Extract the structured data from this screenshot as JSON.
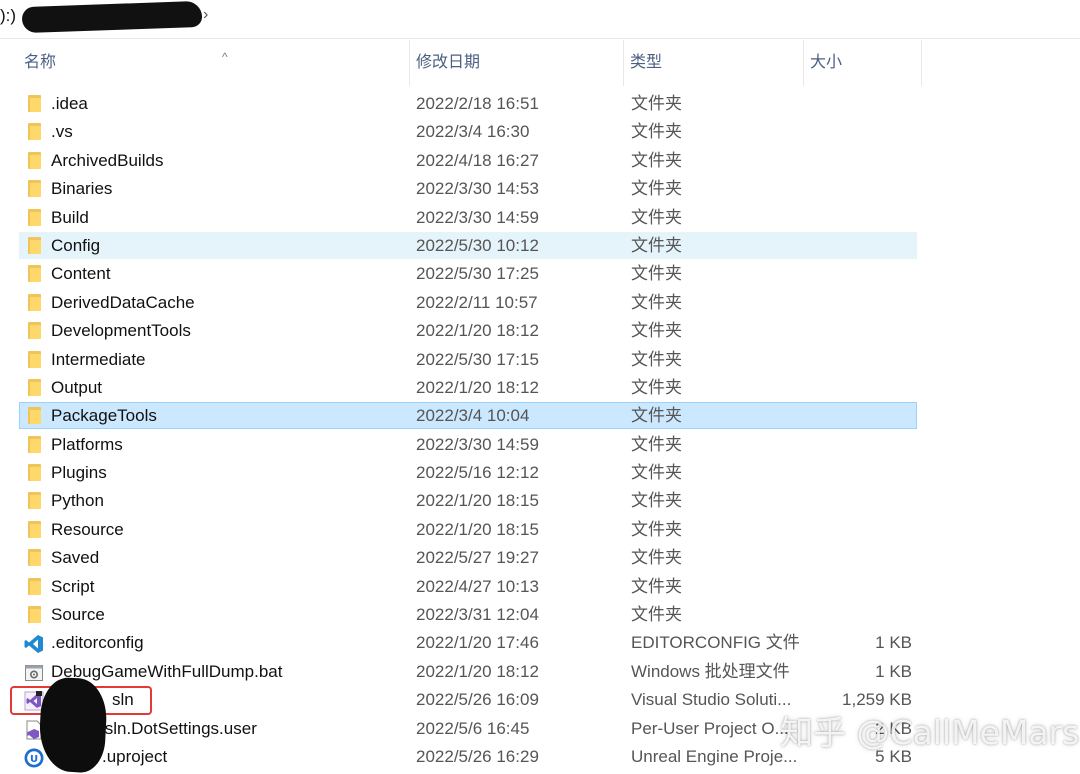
{
  "breadcrumb": {
    "drive": "):)"
  },
  "columns": {
    "name": "名称",
    "date": "修改日期",
    "type": "类型",
    "size": "大小"
  },
  "files": [
    {
      "name": ".idea",
      "date": "2022/2/18 16:51",
      "type": "文件夹",
      "size": "",
      "icon": "folder-icon"
    },
    {
      "name": ".vs",
      "date": "2022/3/4 16:30",
      "type": "文件夹",
      "size": "",
      "icon": "folder-icon"
    },
    {
      "name": "ArchivedBuilds",
      "date": "2022/4/18 16:27",
      "type": "文件夹",
      "size": "",
      "icon": "folder-icon"
    },
    {
      "name": "Binaries",
      "date": "2022/3/30 14:53",
      "type": "文件夹",
      "size": "",
      "icon": "folder-icon"
    },
    {
      "name": "Build",
      "date": "2022/3/30 14:59",
      "type": "文件夹",
      "size": "",
      "icon": "folder-icon"
    },
    {
      "name": "Config",
      "date": "2022/5/30 10:12",
      "type": "文件夹",
      "size": "",
      "icon": "folder-icon",
      "state": "hover"
    },
    {
      "name": "Content",
      "date": "2022/5/30 17:25",
      "type": "文件夹",
      "size": "",
      "icon": "folder-icon"
    },
    {
      "name": "DerivedDataCache",
      "date": "2022/2/11 10:57",
      "type": "文件夹",
      "size": "",
      "icon": "folder-icon"
    },
    {
      "name": "DevelopmentTools",
      "date": "2022/1/20 18:12",
      "type": "文件夹",
      "size": "",
      "icon": "folder-icon"
    },
    {
      "name": "Intermediate",
      "date": "2022/5/30 17:15",
      "type": "文件夹",
      "size": "",
      "icon": "folder-icon"
    },
    {
      "name": "Output",
      "date": "2022/1/20 18:12",
      "type": "文件夹",
      "size": "",
      "icon": "folder-icon"
    },
    {
      "name": "PackageTools",
      "date": "2022/3/4 10:04",
      "type": "文件夹",
      "size": "",
      "icon": "folder-icon",
      "state": "selected"
    },
    {
      "name": "Platforms",
      "date": "2022/3/30 14:59",
      "type": "文件夹",
      "size": "",
      "icon": "folder-icon"
    },
    {
      "name": "Plugins",
      "date": "2022/5/16 12:12",
      "type": "文件夹",
      "size": "",
      "icon": "folder-icon"
    },
    {
      "name": "Python",
      "date": "2022/1/20 18:15",
      "type": "文件夹",
      "size": "",
      "icon": "folder-icon"
    },
    {
      "name": "Resource",
      "date": "2022/1/20 18:15",
      "type": "文件夹",
      "size": "",
      "icon": "folder-icon"
    },
    {
      "name": "Saved",
      "date": "2022/5/27 19:27",
      "type": "文件夹",
      "size": "",
      "icon": "folder-icon"
    },
    {
      "name": "Script",
      "date": "2022/4/27 10:13",
      "type": "文件夹",
      "size": "",
      "icon": "folder-icon"
    },
    {
      "name": "Source",
      "date": "2022/3/31 12:04",
      "type": "文件夹",
      "size": "",
      "icon": "folder-icon"
    },
    {
      "name": ".editorconfig",
      "date": "2022/1/20 17:46",
      "type": "EDITORCONFIG 文件",
      "size": "1 KB",
      "icon": "vscode-icon"
    },
    {
      "name": "DebugGameWithFullDump.bat",
      "date": "2022/1/20 18:12",
      "type": "Windows 批处理文件",
      "size": "1 KB",
      "icon": "batch-file-icon"
    },
    {
      "name": "sln",
      "date": "2022/5/26 16:09",
      "type": "Visual Studio Soluti...",
      "size": "1,259 KB",
      "icon": "visual-studio-solution-icon"
    },
    {
      "name": ".sln.DotSettings.user",
      "date": "2022/5/6 16:45",
      "type": "Per-User Project O...",
      "size": "2 KB",
      "icon": "visual-studio-file-icon"
    },
    {
      "name": ".uproject",
      "date": "2022/5/26 16:29",
      "type": "Unreal Engine Proje...",
      "size": "5 KB",
      "icon": "unreal-engine-icon"
    }
  ],
  "watermark": "知乎 @CallMeMars",
  "colors": {
    "folder": "#ffd86c",
    "hover": "#e5f3fb",
    "selected": "#cce8ff",
    "selected_border": "#99d1ff",
    "header_text": "#4d6082",
    "annotation_box": "#e53935"
  }
}
